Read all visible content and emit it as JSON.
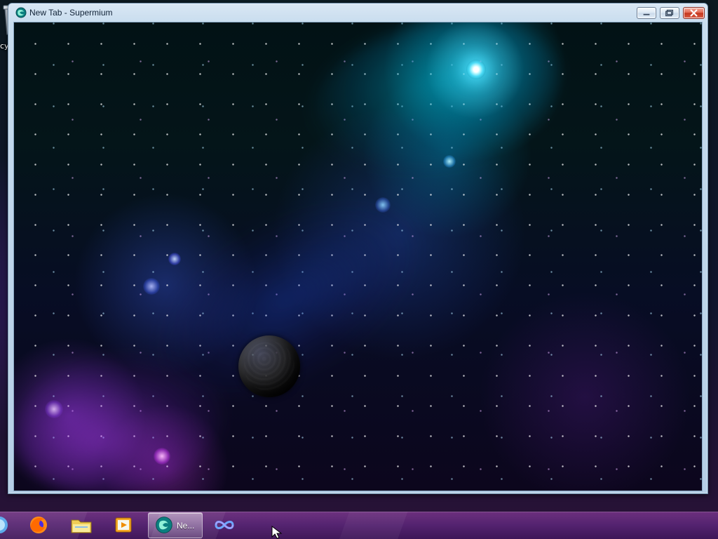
{
  "desktop": {
    "recycle_bin_label": "cycle Bin"
  },
  "window": {
    "title": "New Tab - Supermium"
  },
  "taskbar": {
    "active_label": "Ne..."
  },
  "icons": [
    "recycle-bin-icon",
    "supermium-icon",
    "minimize-icon",
    "maximize-icon",
    "close-icon",
    "start-icon",
    "firefox-icon",
    "file-explorer-icon",
    "media-player-icon",
    "infinity-loop-icon",
    "mouse-cursor-icon"
  ],
  "colors": {
    "window_frame": "#c7dcee",
    "taskbar_purple": "#52206e",
    "nebula_cyan": "#54e2ff",
    "nebula_purple": "#b43cff"
  }
}
